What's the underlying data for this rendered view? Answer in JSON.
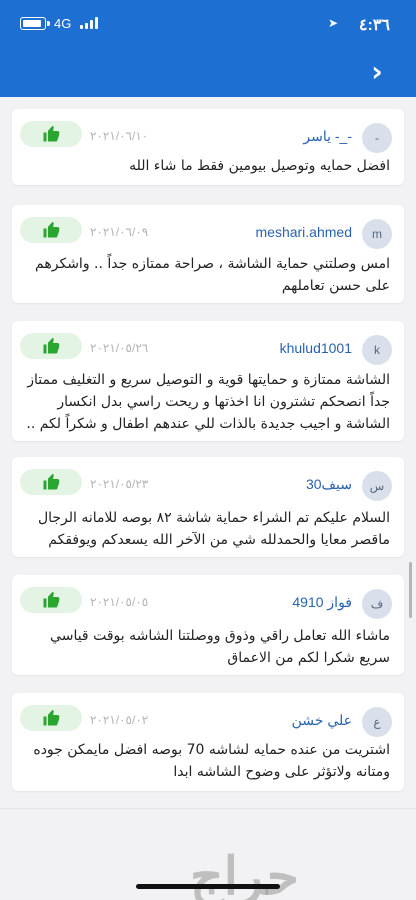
{
  "status_bar": {
    "time": "٤:٣٦",
    "network": "4G"
  },
  "header": {
    "back_icon": "chevron-right-icon",
    "color": "#1e6fd2"
  },
  "reviews": [
    {
      "avatar": "-",
      "username": "-_- ياسر",
      "date": "٢٠٢١/٠٦/١٠",
      "text": "افضل حمايه وتوصيل بيومين فقط ما شاء الله"
    },
    {
      "avatar": "m",
      "username": "meshari.ahmed",
      "date": "٢٠٢١/٠٦/٠٩",
      "text": "امس وصلتني حماية الشاشة ، صراحة ممتازه جداً .. واشكرهم على حسن تعاملهم"
    },
    {
      "avatar": "k",
      "username": "khulud1001",
      "date": "٢٠٢١/٠٥/٢٦",
      "text": "الشاشة ممتازة و حمايتها قوية و التوصيل سريع و التغليف ممتاز جداً انصحكم تشترون انا اخذتها و ريحت راسي بدل انكسار الشاشة و اجيب جديدة بالذات للي عندهم اطفال و شكراً لكم .."
    },
    {
      "avatar": "س",
      "username": "سيف30",
      "date": "٢٠٢١/٠٥/٢٣",
      "text": "السلام عليكم تم الشراء حماية شاشة ٨٢ بوصه للامانه الرجال ماقصر معايا والحمدلله شي من الآخر الله يسعدكم ويوفقكم"
    },
    {
      "avatar": "ف",
      "username": "فواز 4910",
      "date": "٢٠٢١/٠٥/٠٥",
      "text": "ماشاء الله تعامل راقي  وذوق ووصلتنا الشاشه بوقت قياسي سريع شكرا لكم من الاعماق"
    },
    {
      "avatar": "ع",
      "username": "علي خشن",
      "date": "٢٠٢١/٠٥/٠٢",
      "text": "اشتريت من عنده حمايه لشاشه 70 بوصه افضل مايمكن جوده ومتانه  ولاتؤثر على وضوح الشاشه ابدا"
    }
  ],
  "like_icon": "thumbs-up-icon",
  "like_color": "#2aa52f",
  "watermark": "حراج"
}
